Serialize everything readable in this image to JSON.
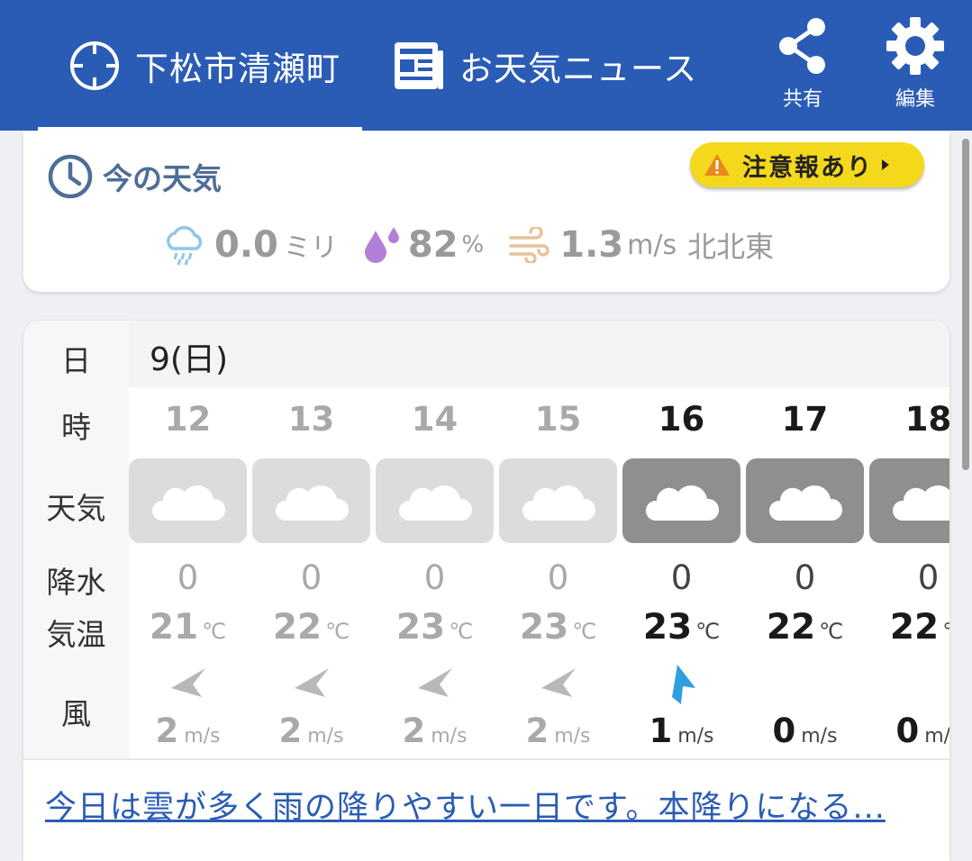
{
  "header": {
    "location_tab": "下松市清瀬町",
    "news_tab": "お天気ニュース",
    "share_label": "共有",
    "edit_label": "編集"
  },
  "current": {
    "title": "今の天気",
    "warning_badge": "注意報あり",
    "precip_value": "0.0",
    "precip_unit": "ミリ",
    "humidity_value": "82",
    "humidity_unit": "%",
    "wind_value": "1.3",
    "wind_unit": "m/s",
    "wind_direction": "北北東"
  },
  "forecast": {
    "row_labels": {
      "day": "日",
      "hour": "時",
      "weather": "天気",
      "precip": "降水",
      "temp": "気温",
      "wind": "風"
    },
    "date": "9(日)",
    "temp_unit": "℃",
    "wind_unit": "m/s",
    "hours": [
      {
        "hour": "12",
        "weather_icon": "cloud-icon",
        "precip": "0",
        "temp": "21",
        "wind": "2",
        "wind_icon": "wind-arrow-icon",
        "past": true
      },
      {
        "hour": "13",
        "weather_icon": "cloud-icon",
        "precip": "0",
        "temp": "22",
        "wind": "2",
        "wind_icon": "wind-arrow-icon",
        "past": true
      },
      {
        "hour": "14",
        "weather_icon": "cloud-icon",
        "precip": "0",
        "temp": "23",
        "wind": "2",
        "wind_icon": "wind-arrow-icon",
        "past": true
      },
      {
        "hour": "15",
        "weather_icon": "cloud-icon",
        "precip": "0",
        "temp": "23",
        "wind": "2",
        "wind_icon": "wind-arrow-icon",
        "past": true
      },
      {
        "hour": "16",
        "weather_icon": "cloud-icon",
        "precip": "0",
        "temp": "23",
        "wind": "1",
        "wind_icon": "wind-arrow-icon",
        "past": false
      },
      {
        "hour": "17",
        "weather_icon": "cloud-icon",
        "precip": "0",
        "temp": "22",
        "wind": "0",
        "wind_icon": "",
        "past": false
      },
      {
        "hour": "18",
        "weather_icon": "cloud-icon",
        "precip": "0",
        "temp": "22",
        "wind": "0",
        "wind_icon": "",
        "past": false
      }
    ],
    "summary_link": "今日は雲が多く雨の降りやすい一日です。本降りになる..."
  },
  "colors": {
    "header_bg": "#2a5cb5",
    "title_text": "#4d6e97",
    "warning_bg": "#f4d81c",
    "humidity_drop": "#b37fd6",
    "wind_icon": "#e6c49a",
    "active_wind_arrow": "#2f9fe0",
    "link": "#2a5cb5"
  }
}
